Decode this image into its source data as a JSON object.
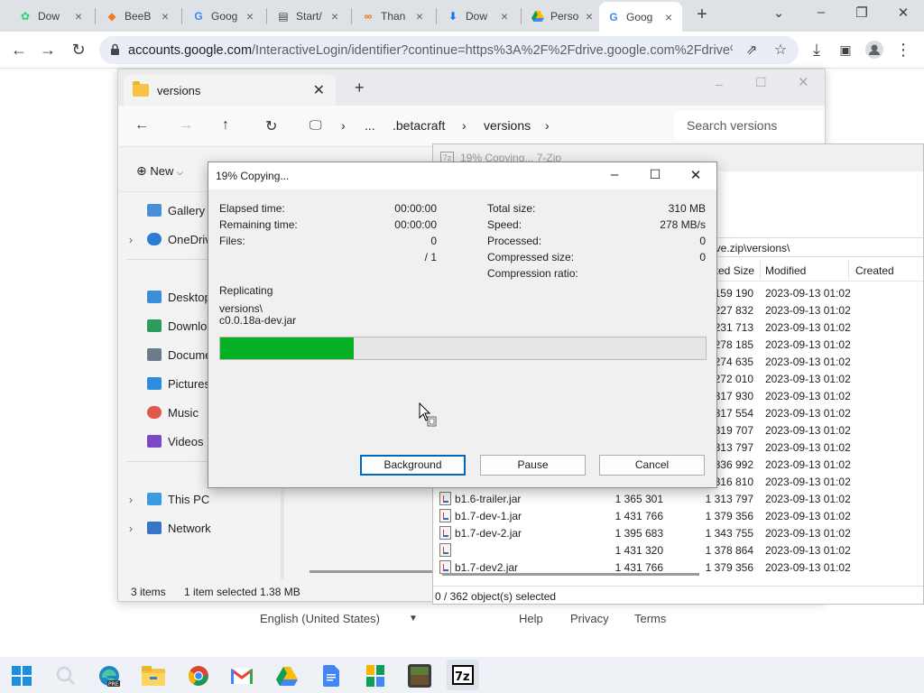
{
  "chrome": {
    "tabs": [
      {
        "title": "Dow",
        "icon": "modrinth-icon"
      },
      {
        "title": "BeeB",
        "icon": "beebom-icon"
      },
      {
        "title": "Goog",
        "icon": "google-icon"
      },
      {
        "title": "Start/",
        "icon": "page-icon"
      },
      {
        "title": "Than",
        "icon": "link-icon"
      },
      {
        "title": "Dow",
        "icon": "download-icon"
      },
      {
        "title": "Perso",
        "icon": "drive-icon"
      },
      {
        "title": "Goog",
        "icon": "google-icon"
      }
    ],
    "active_tab_index": 7,
    "url_domain": "accounts.google.com",
    "url_rest": "/InteractiveLogin/identifier?continue=https%3A%2F%2Fdrive.google.com%2Fdrive%2..."
  },
  "google_page": {
    "language": "English (United States)",
    "help": "Help",
    "privacy": "Privacy",
    "terms": "Terms"
  },
  "explorer": {
    "tab_title": "versions",
    "breadcrumb": [
      "...",
      ".betacraft",
      "versions"
    ],
    "search_placeholder": "Search versions",
    "new_label": "New",
    "sidebar": [
      "Gallery",
      "OneDrive",
      "Desktop",
      "Downloads",
      "Documents",
      "Pictures",
      "Music",
      "Videos",
      "This PC",
      "Network"
    ],
    "status_items": "3 items",
    "status_selected": "1 item selected  1.38 MB"
  },
  "sevenzip_fm": {
    "title": "19% Copying... 7-Zip",
    "path": "ive.zip\\versions\\",
    "headers": {
      "packed": "ked Size",
      "modified": "Modified",
      "created": "Created"
    },
    "rows": [
      {
        "name": "",
        "size": "",
        "packed": "159 190",
        "modified": "2023-09-13 01:02"
      },
      {
        "name": "",
        "size": "",
        "packed": "227 832",
        "modified": "2023-09-13 01:02"
      },
      {
        "name": "",
        "size": "",
        "packed": "231 713",
        "modified": "2023-09-13 01:02"
      },
      {
        "name": "",
        "size": "",
        "packed": "278 185",
        "modified": "2023-09-13 01:02"
      },
      {
        "name": "",
        "size": "",
        "packed": "274 635",
        "modified": "2023-09-13 01:02"
      },
      {
        "name": "",
        "size": "",
        "packed": "272 010",
        "modified": "2023-09-13 01:02"
      },
      {
        "name": "",
        "size": "",
        "packed": "317 930",
        "modified": "2023-09-13 01:02"
      },
      {
        "name": "",
        "size": "",
        "packed": "317 554",
        "modified": "2023-09-13 01:02"
      },
      {
        "name": "",
        "size": "",
        "packed": "319 707",
        "modified": "2023-09-13 01:02"
      },
      {
        "name": "",
        "size": "",
        "packed": "313 797",
        "modified": "2023-09-13 01:02"
      },
      {
        "name": "",
        "size": "",
        "packed": "336 992",
        "modified": "2023-09-13 01:02"
      },
      {
        "name": "",
        "size": "",
        "packed": "316 810",
        "modified": "2023-09-13 01:02"
      },
      {
        "name": "b1.6-trailer.jar",
        "size": "1 365 301",
        "packed": "1 313 797",
        "modified": "2023-09-13 01:02"
      },
      {
        "name": "b1.7-dev-1.jar",
        "size": "1 431 766",
        "packed": "1 379 356",
        "modified": "2023-09-13 01:02"
      },
      {
        "name": "b1.7-dev-2.jar",
        "size": "1 395 683",
        "packed": "1 343 755",
        "modified": "2023-09-13 01:02"
      },
      {
        "name": "",
        "size": "1 431 320",
        "packed": "1 378 864",
        "modified": "2023-09-13 01:02"
      },
      {
        "name": "b1.7-dev2.jar",
        "size": "1 431 766",
        "packed": "1 379 356",
        "modified": "2023-09-13 01:02"
      }
    ],
    "status": "0 / 362 object(s) selected"
  },
  "progress": {
    "title": "19% Copying...",
    "elapsed_label": "Elapsed time:",
    "elapsed": "00:00:00",
    "remaining_label": "Remaining time:",
    "remaining": "00:00:00",
    "files_label": "Files:",
    "files": "0",
    "files_total": "/ 1",
    "total_size_label": "Total size:",
    "total_size": "310 MB",
    "speed_label": "Speed:",
    "speed": "278 MB/s",
    "processed_label": "Processed:",
    "processed": "0",
    "compressed_label": "Compressed size:",
    "compressed": "0",
    "ratio_label": "Compression ratio:",
    "operation": "Replicating",
    "file_line1": "versions\\",
    "file_line2": "c0.0.18a-dev.jar",
    "percent": 27.5,
    "buttons": {
      "background": "Background",
      "pause": "Pause",
      "cancel": "Cancel"
    }
  },
  "taskbar": {
    "apps": [
      "start-icon",
      "search-icon",
      "edge-beta-icon",
      "file-explorer-icon",
      "chrome-icon",
      "gmail-icon",
      "google-drive-icon",
      "google-docs-icon",
      "google-sheets-icon",
      "minecraft-icon",
      "sevenzip-icon"
    ]
  }
}
